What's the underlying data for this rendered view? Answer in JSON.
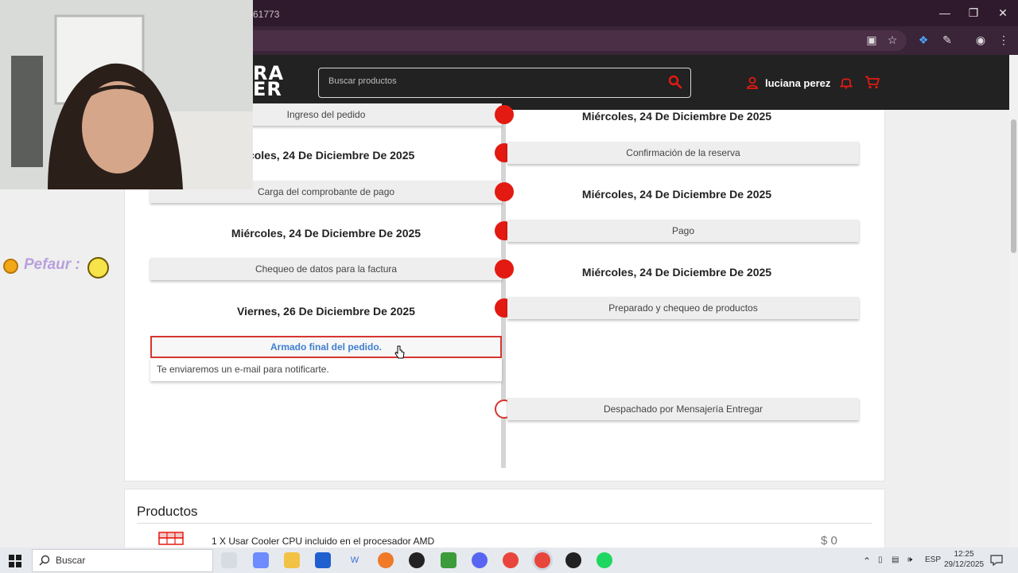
{
  "browser": {
    "url_partial": "61773"
  },
  "header": {
    "logo_line1": "RA",
    "logo_line2": "ER",
    "search_placeholder": "Buscar productos",
    "user_name": "luciana perez"
  },
  "timeline": {
    "steps": [
      {
        "label": "Ingreso del pedido",
        "date": "Miércoles, 24 De Diciembre De 2025"
      },
      {
        "label": "Confirmación de la reserva",
        "date": "Miércoles, 24 De Diciembre De 2025"
      },
      {
        "label": "Carga del comprobante de pago",
        "date": "Miércoles, 24 De Diciembre De 2025"
      },
      {
        "label": "Pago",
        "date": "Miércoles, 24 De Diciembre De 2025"
      },
      {
        "label": "Chequeo de datos para la factura",
        "date": "Miércoles, 24 De Diciembre De 2025"
      },
      {
        "label": "Preparado y chequeo de productos",
        "date": "Viernes, 26 De Diciembre De 2025"
      },
      {
        "label": "Armado final del pedido.",
        "note": "Te enviaremos un e-mail para notificarte."
      },
      {
        "label": "Despachado por Mensajería Entregar"
      }
    ],
    "first_date_partial": "ércoles, 24 De Diciembre De 2025"
  },
  "products": {
    "title": "Productos",
    "items": [
      {
        "name": "1 X Usar Cooler CPU incluido en el procesador AMD",
        "price": "$ 0"
      }
    ]
  },
  "overlay": {
    "chat_user": "Pefaur :"
  },
  "taskbar": {
    "search_label": "Buscar",
    "language": "ESP",
    "time": "12:25",
    "date": "29/12/2025"
  },
  "colors": {
    "accent": "#e31a12",
    "header_bg": "#222222",
    "link": "#3f7fd0"
  }
}
